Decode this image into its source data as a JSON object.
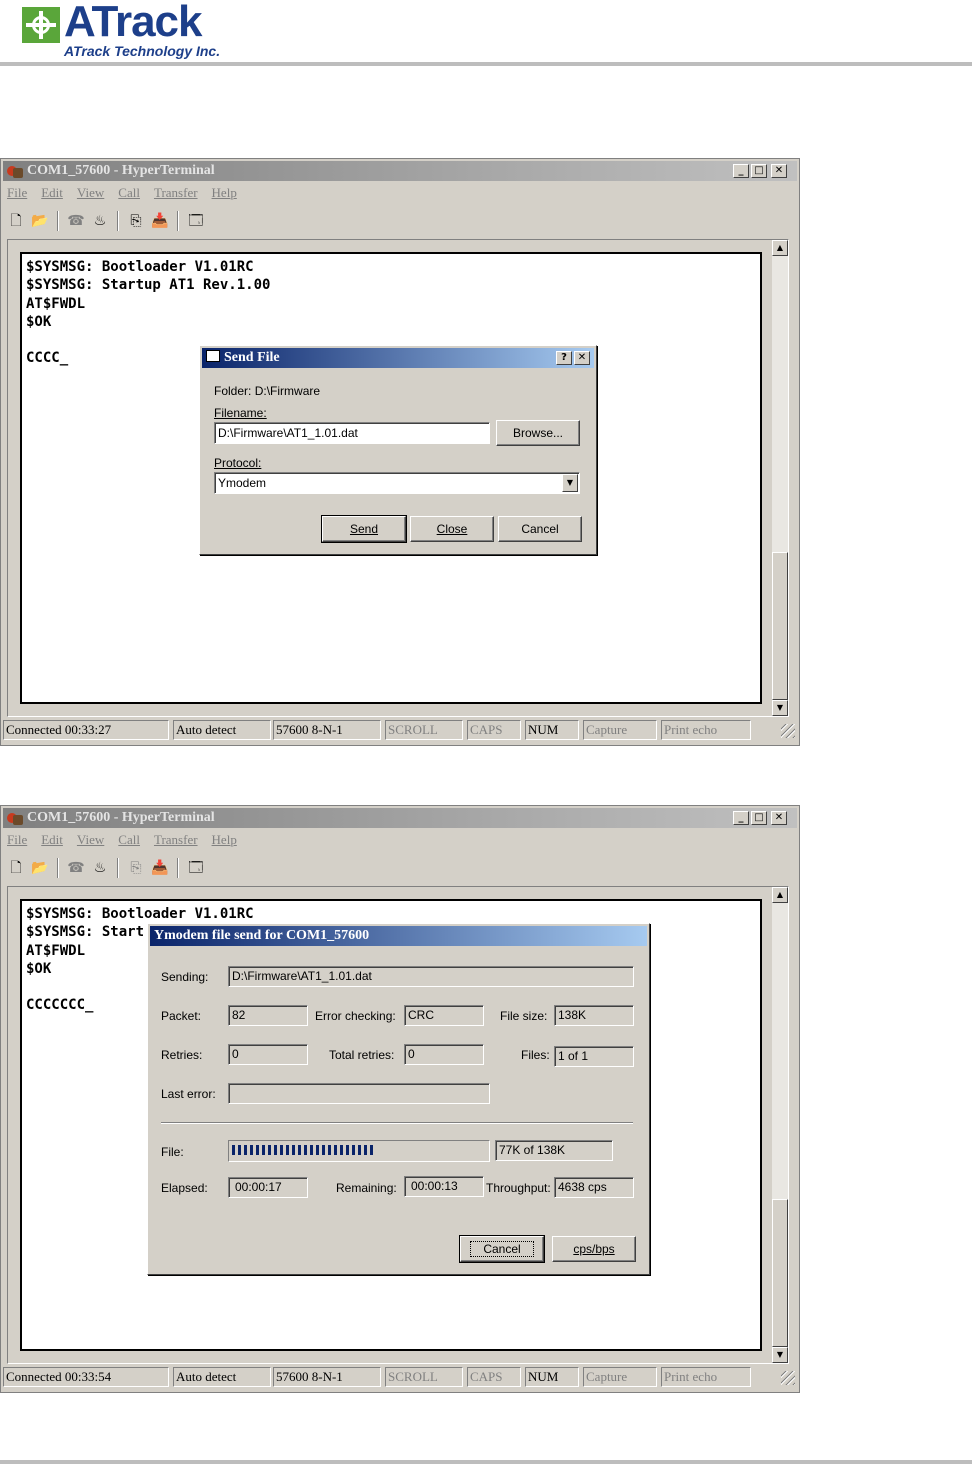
{
  "header": {
    "logo_name": "ATrack",
    "logo_subtitle": "ATrack Technology Inc."
  },
  "menu": [
    "File",
    "Edit",
    "View",
    "Call",
    "Transfer",
    "Help"
  ],
  "window1": {
    "title": "COM1_57600 - HyperTerminal",
    "terminal_text": "$SYSMSG: Bootloader V1.01RC\n$SYSMSG: Startup AT1 Rev.1.00\nAT$FWDL\n$OK\n\nCCCC_",
    "status": {
      "connected": "Connected 00:33:27",
      "detect": "Auto detect",
      "baud": "57600 8-N-1",
      "scroll": "SCROLL",
      "caps": "CAPS",
      "num": "NUM",
      "capture": "Capture",
      "print_echo": "Print echo"
    },
    "send_file_dialog": {
      "title": "Send File",
      "folder_label": "Folder:",
      "folder_value": "D:\\Firmware",
      "filename_label": "Filename:",
      "filename_value": "D:\\Firmware\\AT1_1.01.dat",
      "browse_label": "Browse...",
      "protocol_label": "Protocol:",
      "protocol_value": "Ymodem",
      "send_label": "Send",
      "close_label": "Close",
      "cancel_label": "Cancel"
    }
  },
  "window2": {
    "title": "COM1_57600 - HyperTerminal",
    "terminal_text": "$SYSMSG: Bootloader V1.01RC\n$SYSMSG: Start\nAT$FWDL\n$OK\n\nCCCCCCC_",
    "status": {
      "connected": "Connected 00:33:54",
      "detect": "Auto detect",
      "baud": "57600 8-N-1",
      "scroll": "SCROLL",
      "caps": "CAPS",
      "num": "NUM",
      "capture": "Capture",
      "print_echo": "Print echo"
    },
    "ymodem_dialog": {
      "title": "Ymodem file send for COM1_57600",
      "sending_label": "Sending:",
      "sending_value": "D:\\Firmware\\AT1_1.01.dat",
      "packet_label": "Packet:",
      "packet_value": "82",
      "error_checking_label": "Error checking:",
      "error_checking_value": "CRC",
      "file_size_label": "File size:",
      "file_size_value": "138K",
      "retries_label": "Retries:",
      "retries_value": "0",
      "total_retries_label": "Total retries:",
      "total_retries_value": "0",
      "files_label": "Files:",
      "files_value": "1 of 1",
      "last_error_label": "Last error:",
      "last_error_value": "",
      "file_label": "File:",
      "file_progress_fraction": 0.56,
      "file_progress_text": "77K of 138K",
      "elapsed_label": "Elapsed:",
      "elapsed_value": "00:00:17",
      "remaining_label": "Remaining:",
      "remaining_value": "00:00:13",
      "throughput_label": "Throughput:",
      "throughput_value": "4638 cps",
      "cancel_label": "Cancel",
      "cps_label": "cps/bps"
    }
  }
}
